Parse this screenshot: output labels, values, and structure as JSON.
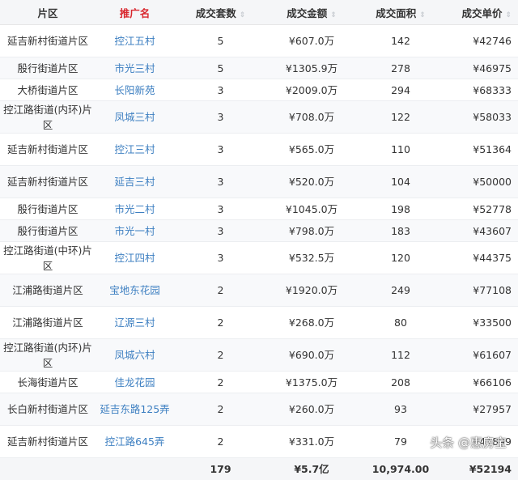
{
  "columns": [
    "片区",
    "推广名",
    "成交套数",
    "成交金额",
    "成交面积",
    "成交单价"
  ],
  "sort_icon": "⇕",
  "rows": [
    [
      "延吉新村街道片区",
      "控江五村",
      "5",
      "¥607.0万",
      "142",
      "¥42746"
    ],
    [
      "殷行街道片区",
      "市光三村",
      "5",
      "¥1305.9万",
      "278",
      "¥46975"
    ],
    [
      "大桥街道片区",
      "长阳新苑",
      "3",
      "¥2009.0万",
      "294",
      "¥68333"
    ],
    [
      "控江路街道(内环)片区",
      "凤城三村",
      "3",
      "¥708.0万",
      "122",
      "¥58033"
    ],
    [
      "延吉新村街道片区",
      "控江三村",
      "3",
      "¥565.0万",
      "110",
      "¥51364"
    ],
    [
      "延吉新村街道片区",
      "延吉三村",
      "3",
      "¥520.0万",
      "104",
      "¥50000"
    ],
    [
      "殷行街道片区",
      "市光二村",
      "3",
      "¥1045.0万",
      "198",
      "¥52778"
    ],
    [
      "殷行街道片区",
      "市光一村",
      "3",
      "¥798.0万",
      "183",
      "¥43607"
    ],
    [
      "控江路街道(中环)片区",
      "控江四村",
      "3",
      "¥532.5万",
      "120",
      "¥44375"
    ],
    [
      "江浦路街道片区",
      "宝地东花园",
      "2",
      "¥1920.0万",
      "249",
      "¥77108"
    ],
    [
      "江浦路街道片区",
      "辽源三村",
      "2",
      "¥268.0万",
      "80",
      "¥33500"
    ],
    [
      "控江路街道(内环)片区",
      "凤城六村",
      "2",
      "¥690.0万",
      "112",
      "¥61607"
    ],
    [
      "长海街道片区",
      "佳龙花园",
      "2",
      "¥1375.0万",
      "208",
      "¥66106"
    ],
    [
      "长白新村街道片区",
      "延吉东路125弄",
      "2",
      "¥260.0万",
      "93",
      "¥27957"
    ],
    [
      "延吉新村街道片区",
      "控江路645弄",
      "2",
      "¥331.0万",
      "79",
      "¥41899"
    ]
  ],
  "totals": {
    "count": "179",
    "amount": "¥5.7亿",
    "area": "10,974.00",
    "price": "¥52194"
  },
  "watermark": "头条 @惠房宝"
}
